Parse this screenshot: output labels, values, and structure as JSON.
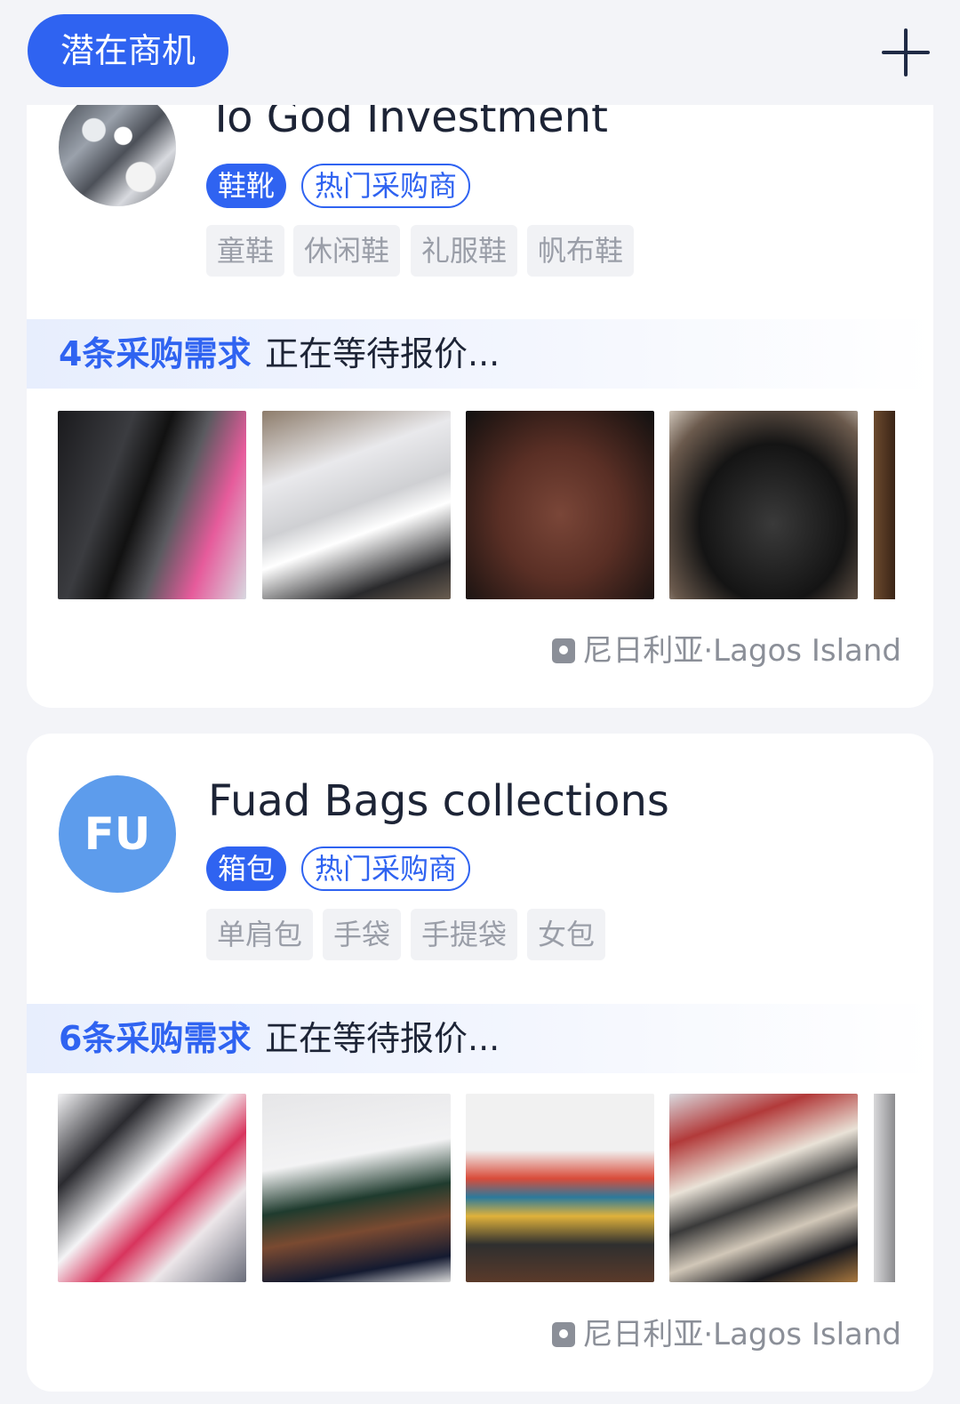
{
  "header": {
    "tab_label": "潜在商机",
    "add_icon": "plus-icon"
  },
  "cards": [
    {
      "company": "To God Investment",
      "category": "鞋靴",
      "badge": "热门采购商",
      "tags": [
        "童鞋",
        "休闲鞋",
        "礼服鞋",
        "帆布鞋"
      ],
      "request_count": "4条采购需求",
      "status": "正在等待报价...",
      "location": "尼日利亚·Lagos Island"
    },
    {
      "company": "Fuad Bags collections",
      "avatar_initials": "FU",
      "category": "箱包",
      "badge": "热门采购商",
      "tags": [
        "单肩包",
        "手袋",
        "手提袋",
        "女包"
      ],
      "request_count": "6条采购需求",
      "status": "正在等待报价...",
      "location": "尼日利亚·Lagos Island"
    }
  ]
}
